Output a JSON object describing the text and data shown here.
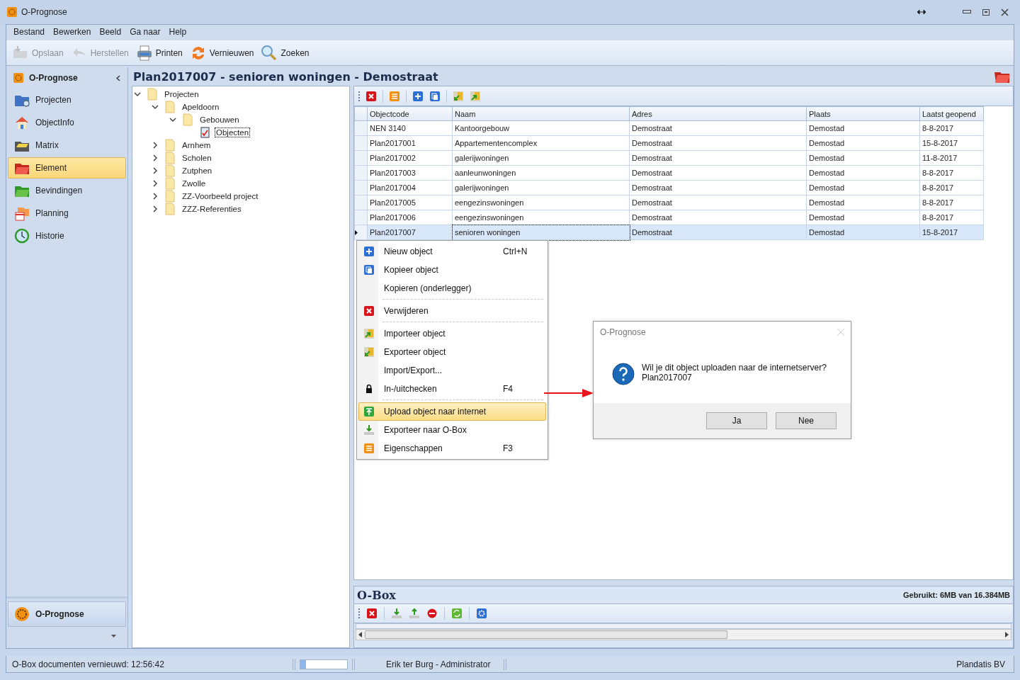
{
  "window": {
    "title": "O-Prognose"
  },
  "menu_bar": [
    "Bestand",
    "Bewerken",
    "Beeld",
    "Ga naar",
    "Help"
  ],
  "toolbar": [
    {
      "label": "Opslaan",
      "disabled": true
    },
    {
      "label": "Herstellen",
      "disabled": true
    },
    {
      "label": "Printen",
      "disabled": false
    },
    {
      "label": "Vernieuwen",
      "disabled": false
    },
    {
      "label": "Zoeken",
      "disabled": false
    }
  ],
  "nav": {
    "title": "O-Prognose",
    "items": [
      {
        "label": "Projecten",
        "selected": false
      },
      {
        "label": "ObjectInfo",
        "selected": false
      },
      {
        "label": "Matrix",
        "selected": false
      },
      {
        "label": "Element",
        "selected": true
      },
      {
        "label": "Bevindingen",
        "selected": false
      },
      {
        "label": "Planning",
        "selected": false
      },
      {
        "label": "Historie",
        "selected": false
      }
    ],
    "footer": "O-Prognose"
  },
  "header": {
    "title": "Plan2017007 - senioren woningen - Demostraat"
  },
  "tree": {
    "items": [
      {
        "label": "Projecten",
        "expanded": true,
        "selected": false,
        "children": [
          {
            "label": "Apeldoorn",
            "expanded": true,
            "selected": false,
            "children": [
              {
                "label": "Gebouwen",
                "expanded": true,
                "selected": false,
                "children": [
                  {
                    "label": "Objecten",
                    "selected": true
                  }
                ]
              }
            ]
          },
          {
            "label": "Arnhem",
            "expanded": false,
            "selected": false
          },
          {
            "label": "Scholen",
            "expanded": false,
            "selected": false
          },
          {
            "label": "Zutphen",
            "expanded": false,
            "selected": false
          },
          {
            "label": "Zwolle",
            "expanded": false,
            "selected": false
          },
          {
            "label": "ZZ-Voorbeeld project",
            "expanded": false,
            "selected": false
          },
          {
            "label": "ZZZ-Referenties",
            "expanded": false,
            "selected": false
          }
        ]
      }
    ]
  },
  "grid": {
    "columns": [
      "Objectcode",
      "Naam",
      "Adres",
      "Plaats",
      "Laatst geopend"
    ],
    "rows": [
      {
        "cells": [
          "NEN 3140",
          "Kantoorgebouw",
          "Demostraat",
          "Demostad",
          "8-8-2017"
        ],
        "selected": false
      },
      {
        "cells": [
          "Plan2017001",
          "Appartementencomplex",
          "Demostraat",
          "Demostad",
          "15-8-2017"
        ],
        "selected": false
      },
      {
        "cells": [
          "Plan2017002",
          "galerijwoningen",
          "Demostraat",
          "Demostad",
          "11-8-2017"
        ],
        "selected": false
      },
      {
        "cells": [
          "Plan2017003",
          "aanleunwoningen",
          "Demostraat",
          "Demostad",
          "8-8-2017"
        ],
        "selected": false
      },
      {
        "cells": [
          "Plan2017004",
          "galerijwoningen",
          "Demostraat",
          "Demostad",
          "8-8-2017"
        ],
        "selected": false
      },
      {
        "cells": [
          "Plan2017005",
          "eengezinswoningen",
          "Demostraat",
          "Demostad",
          "8-8-2017"
        ],
        "selected": false
      },
      {
        "cells": [
          "Plan2017006",
          "eengezinswoningen",
          "Demostraat",
          "Demostad",
          "8-8-2017"
        ],
        "selected": false
      },
      {
        "cells": [
          "Plan2017007",
          "senioren woningen",
          "Demostraat",
          "Demostad",
          "15-8-2017"
        ],
        "selected": true
      }
    ]
  },
  "context_menu": {
    "items": [
      {
        "label": "Nieuw object",
        "shortcut": "Ctrl+N",
        "selected": false,
        "separator_after": false
      },
      {
        "label": "Kopieer object",
        "selected": false,
        "separator_after": false
      },
      {
        "label": "Kopieren (onderlegger)",
        "selected": false,
        "separator_after": true
      },
      {
        "label": "Verwijderen",
        "selected": false,
        "separator_after": true
      },
      {
        "label": "Importeer object",
        "selected": false,
        "separator_after": false
      },
      {
        "label": "Exporteer object",
        "selected": false,
        "separator_after": false
      },
      {
        "label": "Import/Export...",
        "selected": false,
        "separator_after": false
      },
      {
        "label": "In-/uitchecken",
        "shortcut": "F4",
        "selected": false,
        "separator_after": true
      },
      {
        "label": "Upload object naar internet",
        "selected": true,
        "separator_after": false
      },
      {
        "label": "Exporteer naar O-Box",
        "selected": false,
        "separator_after": false
      },
      {
        "label": "Eigenschappen",
        "shortcut": "F3",
        "selected": false,
        "separator_after": false
      }
    ]
  },
  "dialog": {
    "title": "O-Prognose",
    "message": "Wil je dit object uploaden naar de internetserver?",
    "detail": "Plan2017007",
    "buttons": [
      "Ja",
      "Nee"
    ]
  },
  "obox": {
    "title": "O-Box",
    "usage": "Gebruikt: 6MB van 16.384MB"
  },
  "status_bar": {
    "message": "O-Box documenten vernieuwd: 12:56:42",
    "level": 0.12,
    "user": "Erik ter Burg - Administrator",
    "company": "Plandatis BV"
  }
}
